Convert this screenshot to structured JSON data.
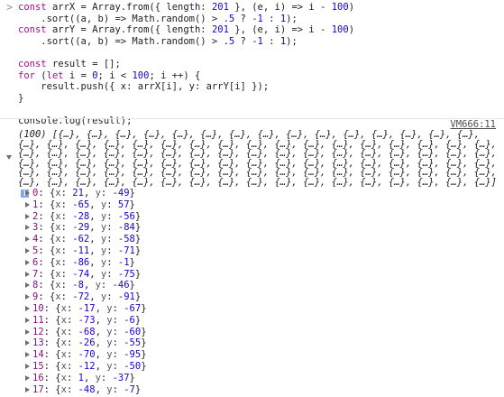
{
  "input": {
    "prompt_icon": "chevron-right-icon",
    "prompt_glyph": ">"
  },
  "output": {
    "source_link": "VM666:11",
    "array_summary": "(100) [{…}, {…}, {…}, {…}, {…}, {…}, {…}, {…}, {…}, {…}, {…}, {…}, {…}, {…}, {…}, {…}, {…}, {…}, {…}, {…}, {…}, {…}, {…}, {…}, {…}, {…}, {…}, {…}, {…}, {…}, {…}, {…}, {…}, {…}, {…}, {…}, {…}, {…}, {…}, {…}, {…}, {…}, {…}, {…}, {…}, {…}, {…}, {…}, {…}, {…}, {…}, {…}, {…}, {…}, {…}, {…}, {…}, {…}, {…}, {…}, {…}, {…}, {…}, {…}, {…}, {…}, {…}, {…}, {…}, {…}, {…}, {…}, {…}, {…}, {…}, {…}, {…}, {…}, {…}, {…}, {…}, {…}, {…}, {…}, {…}, {…}, {…}, {…}, {…}, {…}, {…}, {…}, {…}, {…}, {…}, {…}, {…}, {…}, {…}, {…}]",
    "info_badge": "i",
    "items": [
      {
        "index": "0",
        "x": "21",
        "y": "-49"
      },
      {
        "index": "1",
        "x": "-65",
        "y": "57"
      },
      {
        "index": "2",
        "x": "-28",
        "y": "-56"
      },
      {
        "index": "3",
        "x": "-29",
        "y": "-84"
      },
      {
        "index": "4",
        "x": "-62",
        "y": "-58"
      },
      {
        "index": "5",
        "x": "-11",
        "y": "-71"
      },
      {
        "index": "6",
        "x": "-86",
        "y": "-1"
      },
      {
        "index": "7",
        "x": "-74",
        "y": "-75"
      },
      {
        "index": "8",
        "x": "-8",
        "y": "-46"
      },
      {
        "index": "9",
        "x": "-72",
        "y": "-91"
      },
      {
        "index": "10",
        "x": "-17",
        "y": "-67"
      },
      {
        "index": "11",
        "x": "-73",
        "y": "-6"
      },
      {
        "index": "12",
        "x": "-68",
        "y": "-60"
      },
      {
        "index": "13",
        "x": "-26",
        "y": "-55"
      },
      {
        "index": "14",
        "x": "-70",
        "y": "-95"
      },
      {
        "index": "15",
        "x": "-12",
        "y": "-50"
      },
      {
        "index": "16",
        "x": "1",
        "y": "-37"
      },
      {
        "index": "17",
        "x": "-48",
        "y": "-7"
      }
    ]
  },
  "code_lines": [
    [
      [
        "kw",
        "const "
      ],
      [
        "t",
        "arrX = Array.from({ length: "
      ],
      [
        "num",
        "201"
      ],
      [
        "t",
        " }, (e, i) => i - "
      ],
      [
        "num",
        "100"
      ],
      [
        "t",
        ")"
      ]
    ],
    [
      [
        "t",
        "    .sort((a, b) => Math.random() > "
      ],
      [
        "num",
        ".5"
      ],
      [
        "t",
        " ? "
      ],
      [
        "num",
        "-1"
      ],
      [
        "t",
        " : "
      ],
      [
        "num",
        "1"
      ],
      [
        "t",
        ");"
      ]
    ],
    [
      [
        "kw",
        "const "
      ],
      [
        "t",
        "arrY = Array.from({ length: "
      ],
      [
        "num",
        "201"
      ],
      [
        "t",
        " }, (e, i) => i - "
      ],
      [
        "num",
        "100"
      ],
      [
        "t",
        ")"
      ]
    ],
    [
      [
        "t",
        "    .sort((a, b) => Math.random() > "
      ],
      [
        "num",
        ".5"
      ],
      [
        "t",
        " ? "
      ],
      [
        "num",
        "-1"
      ],
      [
        "t",
        " : "
      ],
      [
        "num",
        "1"
      ],
      [
        "t",
        ");"
      ]
    ],
    [],
    [
      [
        "kw",
        "const "
      ],
      [
        "t",
        "result = [];"
      ]
    ],
    [
      [
        "kw",
        "for "
      ],
      [
        "t",
        "("
      ],
      [
        "kw",
        "let "
      ],
      [
        "t",
        "i = "
      ],
      [
        "num",
        "0"
      ],
      [
        "t",
        "; i < "
      ],
      [
        "num",
        "100"
      ],
      [
        "t",
        "; i ++) {"
      ]
    ],
    [
      [
        "t",
        "    result.push({ x: arrX[i], y: arrY[i] });"
      ]
    ],
    [
      [
        "t",
        "}"
      ]
    ],
    [],
    [
      [
        "t",
        "console.log(result);"
      ]
    ]
  ]
}
